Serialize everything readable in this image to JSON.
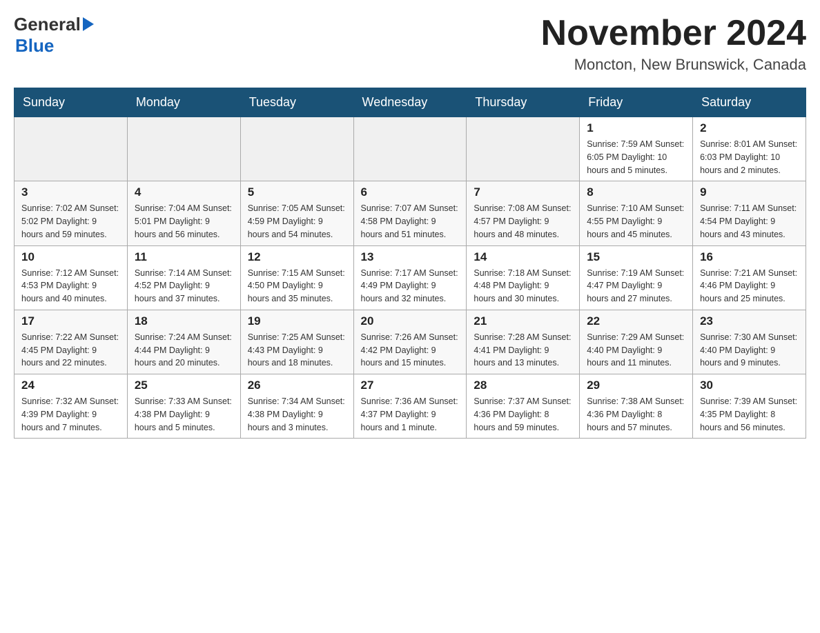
{
  "header": {
    "logo_general": "General",
    "logo_blue": "Blue",
    "month_title": "November 2024",
    "location": "Moncton, New Brunswick, Canada"
  },
  "weekdays": [
    "Sunday",
    "Monday",
    "Tuesday",
    "Wednesday",
    "Thursday",
    "Friday",
    "Saturday"
  ],
  "weeks": [
    {
      "days": [
        {
          "number": "",
          "info": ""
        },
        {
          "number": "",
          "info": ""
        },
        {
          "number": "",
          "info": ""
        },
        {
          "number": "",
          "info": ""
        },
        {
          "number": "",
          "info": ""
        },
        {
          "number": "1",
          "info": "Sunrise: 7:59 AM\nSunset: 6:05 PM\nDaylight: 10 hours\nand 5 minutes."
        },
        {
          "number": "2",
          "info": "Sunrise: 8:01 AM\nSunset: 6:03 PM\nDaylight: 10 hours\nand 2 minutes."
        }
      ]
    },
    {
      "days": [
        {
          "number": "3",
          "info": "Sunrise: 7:02 AM\nSunset: 5:02 PM\nDaylight: 9 hours\nand 59 minutes."
        },
        {
          "number": "4",
          "info": "Sunrise: 7:04 AM\nSunset: 5:01 PM\nDaylight: 9 hours\nand 56 minutes."
        },
        {
          "number": "5",
          "info": "Sunrise: 7:05 AM\nSunset: 4:59 PM\nDaylight: 9 hours\nand 54 minutes."
        },
        {
          "number": "6",
          "info": "Sunrise: 7:07 AM\nSunset: 4:58 PM\nDaylight: 9 hours\nand 51 minutes."
        },
        {
          "number": "7",
          "info": "Sunrise: 7:08 AM\nSunset: 4:57 PM\nDaylight: 9 hours\nand 48 minutes."
        },
        {
          "number": "8",
          "info": "Sunrise: 7:10 AM\nSunset: 4:55 PM\nDaylight: 9 hours\nand 45 minutes."
        },
        {
          "number": "9",
          "info": "Sunrise: 7:11 AM\nSunset: 4:54 PM\nDaylight: 9 hours\nand 43 minutes."
        }
      ]
    },
    {
      "days": [
        {
          "number": "10",
          "info": "Sunrise: 7:12 AM\nSunset: 4:53 PM\nDaylight: 9 hours\nand 40 minutes."
        },
        {
          "number": "11",
          "info": "Sunrise: 7:14 AM\nSunset: 4:52 PM\nDaylight: 9 hours\nand 37 minutes."
        },
        {
          "number": "12",
          "info": "Sunrise: 7:15 AM\nSunset: 4:50 PM\nDaylight: 9 hours\nand 35 minutes."
        },
        {
          "number": "13",
          "info": "Sunrise: 7:17 AM\nSunset: 4:49 PM\nDaylight: 9 hours\nand 32 minutes."
        },
        {
          "number": "14",
          "info": "Sunrise: 7:18 AM\nSunset: 4:48 PM\nDaylight: 9 hours\nand 30 minutes."
        },
        {
          "number": "15",
          "info": "Sunrise: 7:19 AM\nSunset: 4:47 PM\nDaylight: 9 hours\nand 27 minutes."
        },
        {
          "number": "16",
          "info": "Sunrise: 7:21 AM\nSunset: 4:46 PM\nDaylight: 9 hours\nand 25 minutes."
        }
      ]
    },
    {
      "days": [
        {
          "number": "17",
          "info": "Sunrise: 7:22 AM\nSunset: 4:45 PM\nDaylight: 9 hours\nand 22 minutes."
        },
        {
          "number": "18",
          "info": "Sunrise: 7:24 AM\nSunset: 4:44 PM\nDaylight: 9 hours\nand 20 minutes."
        },
        {
          "number": "19",
          "info": "Sunrise: 7:25 AM\nSunset: 4:43 PM\nDaylight: 9 hours\nand 18 minutes."
        },
        {
          "number": "20",
          "info": "Sunrise: 7:26 AM\nSunset: 4:42 PM\nDaylight: 9 hours\nand 15 minutes."
        },
        {
          "number": "21",
          "info": "Sunrise: 7:28 AM\nSunset: 4:41 PM\nDaylight: 9 hours\nand 13 minutes."
        },
        {
          "number": "22",
          "info": "Sunrise: 7:29 AM\nSunset: 4:40 PM\nDaylight: 9 hours\nand 11 minutes."
        },
        {
          "number": "23",
          "info": "Sunrise: 7:30 AM\nSunset: 4:40 PM\nDaylight: 9 hours\nand 9 minutes."
        }
      ]
    },
    {
      "days": [
        {
          "number": "24",
          "info": "Sunrise: 7:32 AM\nSunset: 4:39 PM\nDaylight: 9 hours\nand 7 minutes."
        },
        {
          "number": "25",
          "info": "Sunrise: 7:33 AM\nSunset: 4:38 PM\nDaylight: 9 hours\nand 5 minutes."
        },
        {
          "number": "26",
          "info": "Sunrise: 7:34 AM\nSunset: 4:38 PM\nDaylight: 9 hours\nand 3 minutes."
        },
        {
          "number": "27",
          "info": "Sunrise: 7:36 AM\nSunset: 4:37 PM\nDaylight: 9 hours\nand 1 minute."
        },
        {
          "number": "28",
          "info": "Sunrise: 7:37 AM\nSunset: 4:36 PM\nDaylight: 8 hours\nand 59 minutes."
        },
        {
          "number": "29",
          "info": "Sunrise: 7:38 AM\nSunset: 4:36 PM\nDaylight: 8 hours\nand 57 minutes."
        },
        {
          "number": "30",
          "info": "Sunrise: 7:39 AM\nSunset: 4:35 PM\nDaylight: 8 hours\nand 56 minutes."
        }
      ]
    }
  ]
}
